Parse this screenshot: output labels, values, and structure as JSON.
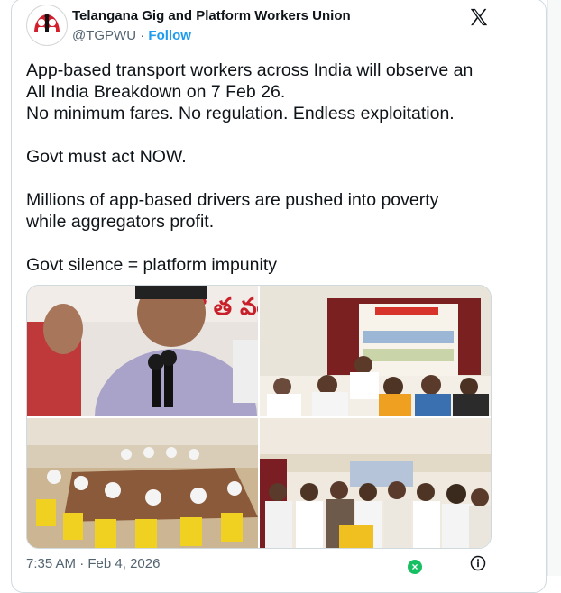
{
  "account": {
    "name": "Telangana Gig and Platform Workers Union",
    "handle": "@TGPWU",
    "separator": "·",
    "follow_label": "Follow"
  },
  "tweet": {
    "lines": [
      "App-based transport workers across India will observe an",
      "All India Breakdown on 7 Feb 26.",
      "No minimum fares. No regulation. Endless exploitation.",
      "",
      "Govt must act NOW.",
      "",
      "Millions of app-based drivers are pushed into poverty",
      "while aggregators profit.",
      "",
      "Govt silence = platform impunity"
    ]
  },
  "media": {
    "photos": [
      {
        "label": "photo-speaker-with-microphones"
      },
      {
        "label": "photo-press-meet-banner"
      },
      {
        "label": "photo-meeting-hall"
      },
      {
        "label": "photo-group-gathering"
      }
    ]
  },
  "footer": {
    "time": "7:35 AM",
    "separator": "·",
    "date": "Feb 4, 2026"
  },
  "icons": {
    "brand": "x-logo-icon",
    "info": "info-icon"
  },
  "colors": {
    "accent": "#1d9bf0",
    "text_primary": "#0f1419",
    "text_secondary": "#536471",
    "border": "#cfd9de"
  }
}
